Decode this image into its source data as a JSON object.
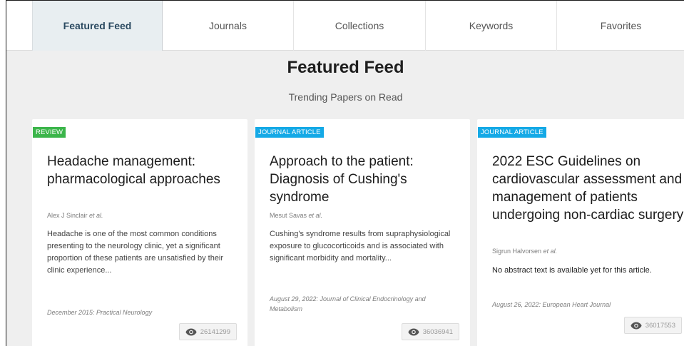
{
  "tabs": [
    {
      "label": "Featured Feed",
      "active": true
    },
    {
      "label": "Journals",
      "active": false
    },
    {
      "label": "Collections",
      "active": false
    },
    {
      "label": "Keywords",
      "active": false
    },
    {
      "label": "Favorites",
      "active": false
    }
  ],
  "header": {
    "title": "Featured Feed",
    "subtitle": "Trending Papers on Read"
  },
  "colors": {
    "review_badge": "#3bb54a",
    "journal_badge": "#14a9e6",
    "active_tab_bg": "#e8eef1",
    "active_tab_text": "#2b4a61"
  },
  "cards": [
    {
      "badge": "REVIEW",
      "title": "Headache management: pharmacological approaches",
      "author": "Alex J Sinclair",
      "etal": "et al.",
      "abstract": "Headache is one of the most common conditions presenting to the neurology clinic, yet a significant proportion of these patients are unsatisfied by their clinic experience...",
      "meta": "December 2015: Practical Neurology",
      "views": "26141299",
      "view_icon": "eye-icon"
    },
    {
      "badge": "JOURNAL ARTICLE",
      "title": "Approach to the patient: Diagnosis of Cushing's syndrome",
      "author": "Mesut Savas",
      "etal": "et al.",
      "abstract": "Cushing's syndrome results from supraphysiological exposure to glucocorticoids and is associated with significant morbidity and mortality...",
      "meta": "August 29, 2022: Journal of Clinical Endocrinology and Metabolism",
      "views": "36036941",
      "view_icon": "eye-icon"
    },
    {
      "badge": "JOURNAL ARTICLE",
      "title": "2022 ESC Guidelines on cardiovascular assessment and management of patients undergoing non-cardiac surgery",
      "author": "Sigrun Halvorsen",
      "etal": "et al.",
      "abstract": "No abstract text is available yet for this article.",
      "meta": "August 26, 2022: European Heart Journal",
      "views": "36017553",
      "view_icon": "eye-icon"
    }
  ]
}
